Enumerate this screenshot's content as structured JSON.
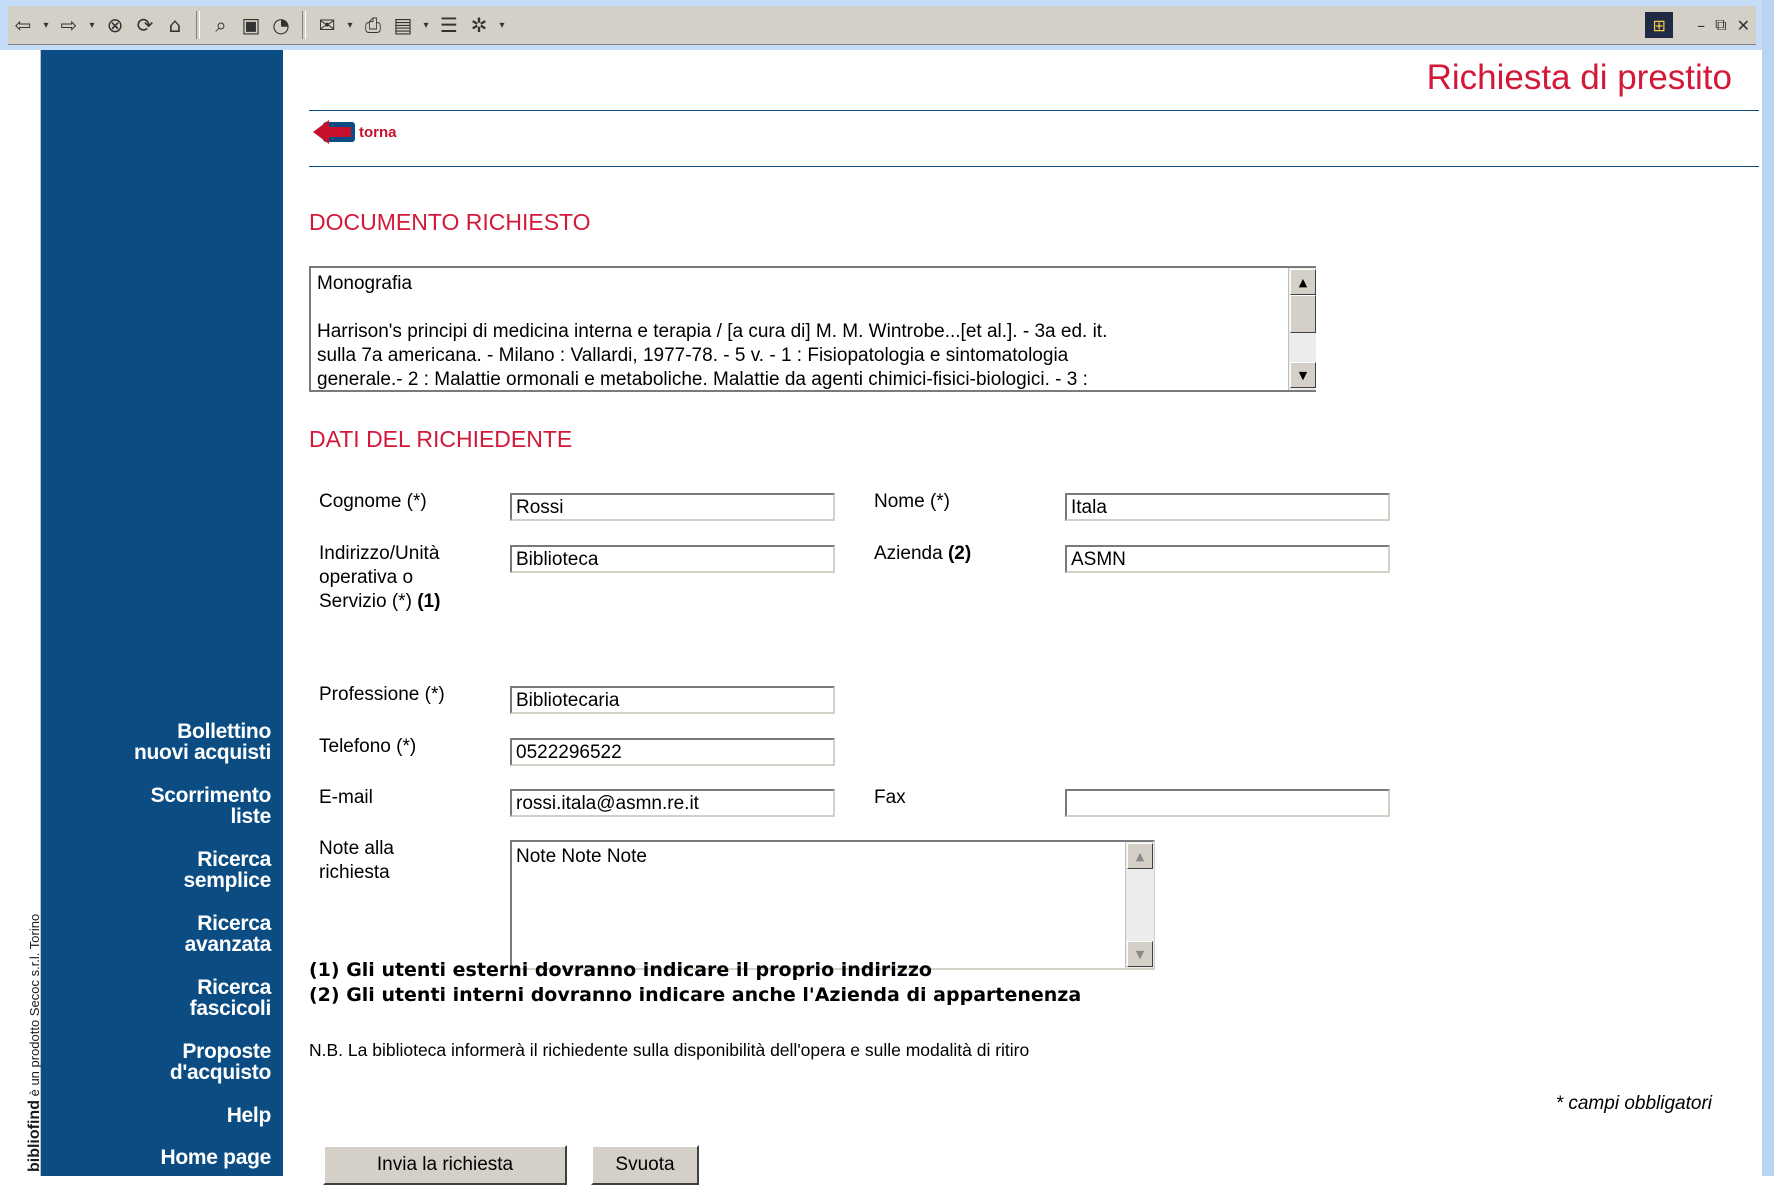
{
  "toolbar": {
    "buttons": [
      "back-icon",
      "forward-icon",
      "stop-icon",
      "refresh-icon",
      "home-icon",
      "search-icon",
      "favorites-icon",
      "history-icon",
      "mail-icon",
      "print-icon",
      "edit-icon",
      "discuss-icon",
      "messenger-icon"
    ]
  },
  "sidebar": {
    "vertical_text": "è un prodotto Secoc s.r.l. Torino",
    "brand": "bibliofind",
    "items": [
      {
        "label": "Bollettino\nnuovi acquisti"
      },
      {
        "label": "Scorrimento\nliste"
      },
      {
        "label": "Ricerca\nsemplice"
      },
      {
        "label": "Ricerca\navanzata"
      },
      {
        "label": "Ricerca\nfascicoli"
      },
      {
        "label": "Proposte\nd'acquisto"
      },
      {
        "label": "Help"
      },
      {
        "label": "Home page"
      }
    ]
  },
  "page": {
    "title": "Richiesta di prestito",
    "back_label": "torna"
  },
  "document": {
    "section_title": "DOCUMENTO RICHIESTO",
    "text": "Monografia\n\nHarrison's principi di medicina interna e terapia / [a cura di] M. M. Wintrobe...[et al.]. - 3a ed. it.\nsulla 7a americana. - Milano : Vallardi, 1977-78. - 5 v. - 1 : Fisiopatologia e sintomatologia\ngenerale.- 2 : Malattie ormonali e metaboliche. Malattie da agenti chimici-fisici-biologici. - 3 :"
  },
  "requester": {
    "section_title": "DATI DEL RICHIEDENTE",
    "cognome_label": "Cognome (*)",
    "cognome_value": "Rossi",
    "nome_label": "Nome (*)",
    "nome_value": "Itala",
    "indirizzo_label_1": "Indirizzo/Unità",
    "indirizzo_label_2": "operativa o",
    "indirizzo_label_3": "Servizio (*)",
    "indirizzo_label_bold": "(1)",
    "indirizzo_value": "Biblioteca",
    "azienda_label": "Azienda",
    "azienda_label_bold": "(2)",
    "azienda_value": "ASMN",
    "professione_label": "Professione (*)",
    "professione_value": "Bibliotecaria",
    "telefono_label": "Telefono (*)",
    "telefono_value": "0522296522",
    "email_label": "E-mail",
    "email_value": "rossi.itala@asmn.re.it",
    "fax_label": "Fax",
    "fax_value": "",
    "note_label_1": "Note alla",
    "note_label_2": "richiesta",
    "note_value": "Note Note Note"
  },
  "footnotes": {
    "note1": "(1) Gli utenti esterni dovranno indicare il proprio indirizzo",
    "note2": "(2) Gli utenti interni dovranno indicare anche l'Azienda di appartenenza",
    "nb": "N.B. La biblioteca informerà il richiedente sulla disponibilità dell'opera e sulle modalità di ritiro",
    "required": "* campi obbligatori"
  },
  "actions": {
    "submit_label": "Invia la richiesta",
    "reset_label": "Svuota"
  },
  "colors": {
    "accent_red": "#d2193a",
    "nav_blue": "#0b4d83"
  }
}
